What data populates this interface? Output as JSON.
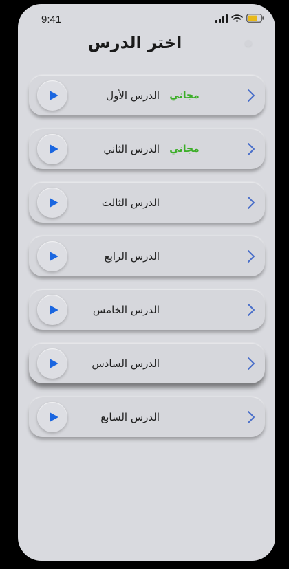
{
  "status_bar": {
    "time": "9:41"
  },
  "header": {
    "title": "اختر الدرس"
  },
  "lessons": [
    {
      "title": "الدرس الأول",
      "badge": "مجاني"
    },
    {
      "title": "الدرس الثاني",
      "badge": "مجاني"
    },
    {
      "title": "الدرس الثالث",
      "badge": ""
    },
    {
      "title": "الدرس الرابع",
      "badge": ""
    },
    {
      "title": "الدرس الخامس",
      "badge": ""
    },
    {
      "title": "الدرس السادس",
      "badge": ""
    },
    {
      "title": "الدرس السابع",
      "badge": ""
    }
  ],
  "icons": {
    "play": "play-icon",
    "chevron": "chevron-right-icon",
    "signal": "signal-icon",
    "wifi": "wifi-icon",
    "battery": "battery-icon"
  },
  "colors": {
    "accent_blue": "#1a66e0",
    "free_green": "#3cae28",
    "battery_yellow": "#e8b91a",
    "background": "#d9dadf"
  }
}
